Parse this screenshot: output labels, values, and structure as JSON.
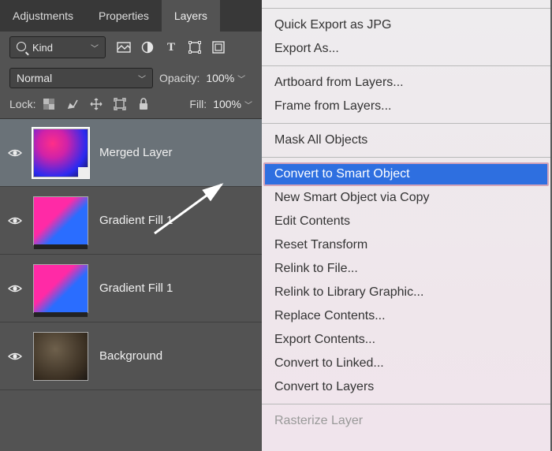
{
  "tabs": {
    "adjustments": "Adjustments",
    "properties": "Properties",
    "layers": "Layers"
  },
  "filter": {
    "label": "Kind"
  },
  "blend": {
    "mode": "Normal",
    "opacity_label": "Opacity:",
    "opacity_value": "100%"
  },
  "lock": {
    "label": "Lock:",
    "fill_label": "Fill:",
    "fill_value": "100%"
  },
  "layers": [
    {
      "name": "Merged Layer"
    },
    {
      "name": "Gradient Fill 1"
    },
    {
      "name": "Gradient Fill 1"
    },
    {
      "name": "Background"
    }
  ],
  "menu": {
    "items_top": [
      "Quick Export as JPG",
      "Export As..."
    ],
    "items_artboard": [
      "Artboard from Layers...",
      "Frame from Layers..."
    ],
    "mask_all": "Mask All Objects",
    "highlighted": "Convert to Smart Object",
    "items_smart": [
      "New Smart Object via Copy",
      "Edit Contents",
      "Reset Transform",
      "Relink to File...",
      "Relink to Library Graphic...",
      "Replace Contents...",
      "Export Contents...",
      "Convert to Linked...",
      "Convert to Layers"
    ],
    "rasterize": "Rasterize Layer"
  }
}
